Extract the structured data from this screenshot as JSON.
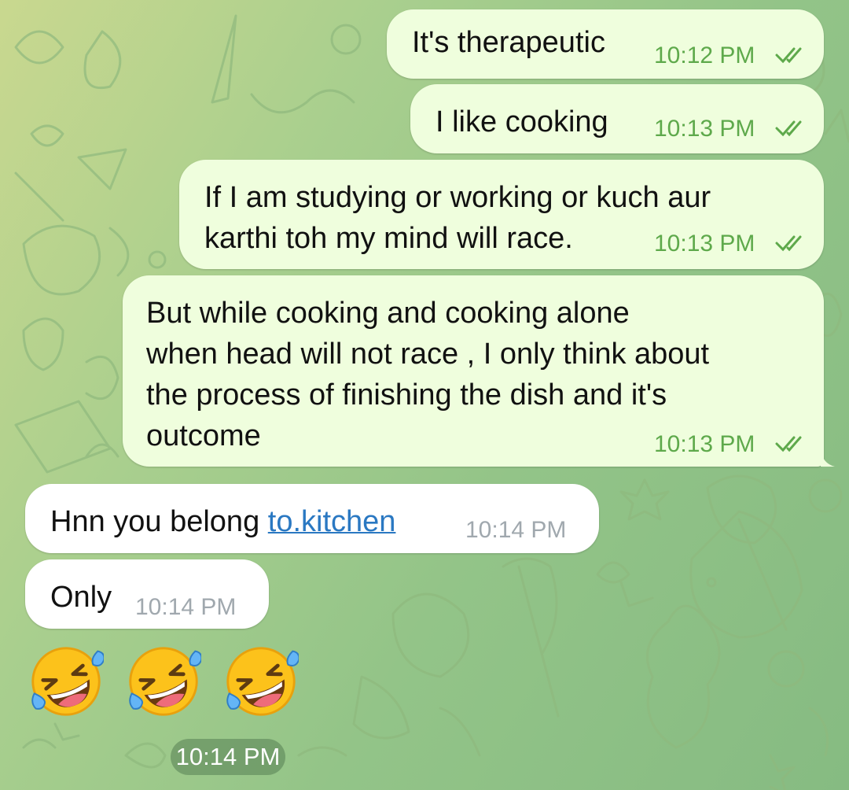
{
  "messages": [
    {
      "direction": "outgoing",
      "text": "It's therapeutic",
      "time": "10:12 PM",
      "status": "read-double-check-icon"
    },
    {
      "direction": "outgoing",
      "text": "I like cooking",
      "time": "10:13 PM",
      "status": "read-double-check-icon"
    },
    {
      "direction": "outgoing",
      "lines": [
        "If I am studying or working or kuch aur",
        "karthi toh my mind will race."
      ],
      "time": "10:13 PM",
      "status": "read-double-check-icon"
    },
    {
      "direction": "outgoing",
      "lines": [
        "But while cooking and cooking alone",
        "when head will not race , I only think about",
        "the process of finishing the dish and it's",
        "outcome"
      ],
      "time": "10:13 PM",
      "status": "read-double-check-icon"
    },
    {
      "direction": "incoming",
      "text_prefix": "Hnn you belong ",
      "link": "to.kitchen",
      "time": "10:14 PM"
    },
    {
      "direction": "incoming",
      "text": "Only",
      "time": "10:14 PM"
    },
    {
      "direction": "incoming",
      "type": "emoji",
      "emoji": [
        "rolling-on-floor-laughing-emoji",
        "rolling-on-floor-laughing-emoji",
        "rolling-on-floor-laughing-emoji"
      ],
      "time": "10:14 PM"
    }
  ],
  "colors": {
    "outgoing_bubble": "#effedd",
    "incoming_bubble": "#ffffff",
    "outgoing_time": "#5ea94b",
    "incoming_time": "#a0a8ae",
    "link": "#2a78c2"
  }
}
